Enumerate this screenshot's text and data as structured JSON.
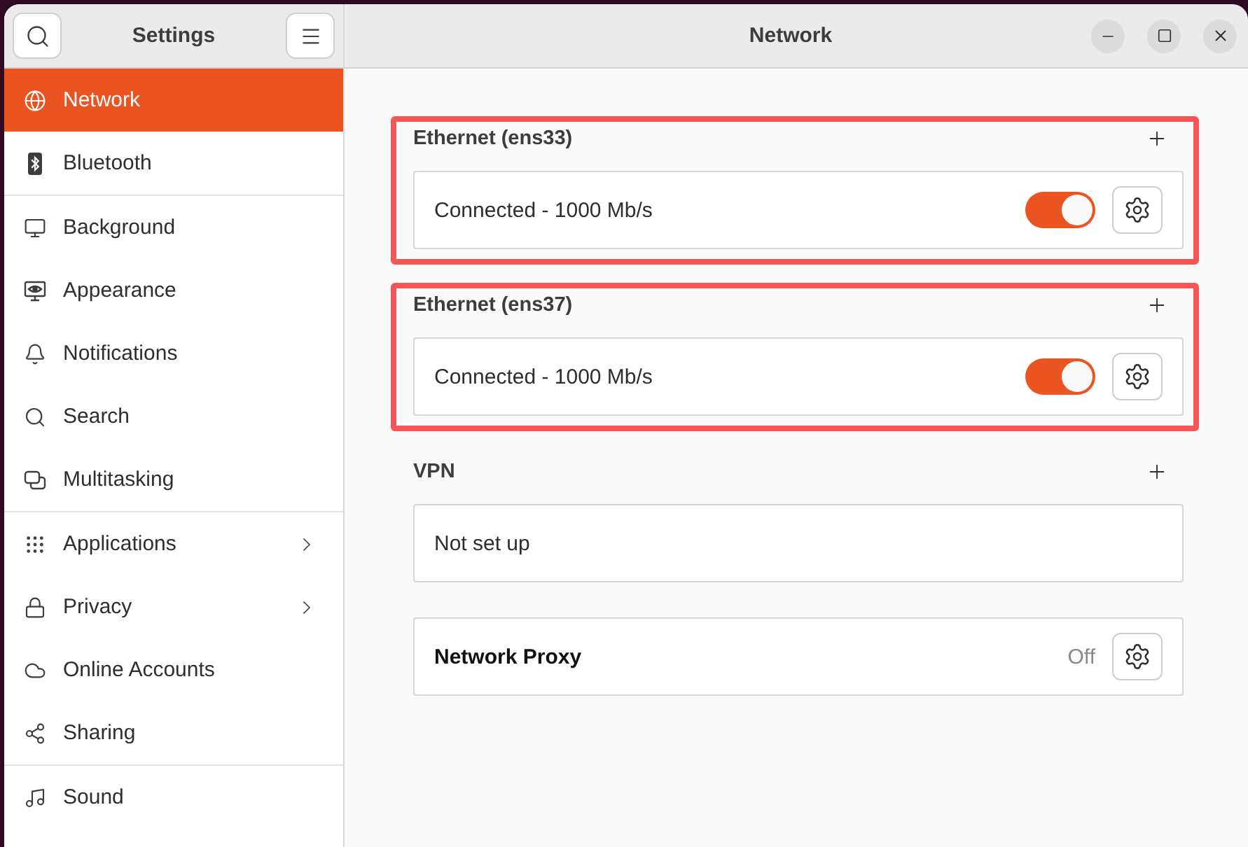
{
  "sidebar": {
    "title": "Settings",
    "groups": [
      {
        "items": [
          {
            "label": "Network",
            "selected": true,
            "submenu": false
          },
          {
            "label": "Bluetooth",
            "selected": false,
            "submenu": false
          }
        ]
      },
      {
        "items": [
          {
            "label": "Background",
            "selected": false,
            "submenu": false
          },
          {
            "label": "Appearance",
            "selected": false,
            "submenu": false
          },
          {
            "label": "Notifications",
            "selected": false,
            "submenu": false
          },
          {
            "label": "Search",
            "selected": false,
            "submenu": false
          },
          {
            "label": "Multitasking",
            "selected": false,
            "submenu": false
          }
        ]
      },
      {
        "items": [
          {
            "label": "Applications",
            "selected": false,
            "submenu": true
          },
          {
            "label": "Privacy",
            "selected": false,
            "submenu": true
          },
          {
            "label": "Online Accounts",
            "selected": false,
            "submenu": false
          },
          {
            "label": "Sharing",
            "selected": false,
            "submenu": false
          }
        ]
      },
      {
        "items": [
          {
            "label": "Sound",
            "selected": false,
            "submenu": false
          }
        ]
      }
    ]
  },
  "page": {
    "title": "Network",
    "sections": [
      {
        "heading": "Ethernet (ens33)",
        "highlighted": true,
        "row": {
          "kind": "connection",
          "label": "Connected - 1000 Mb/s",
          "on": true
        }
      },
      {
        "heading": "Ethernet (ens37)",
        "highlighted": true,
        "row": {
          "kind": "connection",
          "label": "Connected - 1000 Mb/s",
          "on": true
        }
      },
      {
        "heading": "VPN",
        "highlighted": false,
        "row": {
          "kind": "message",
          "label": "Not set up"
        }
      },
      {
        "highlighted": false,
        "row": {
          "kind": "setting",
          "label": "Network Proxy",
          "value": "Off"
        }
      }
    ]
  }
}
